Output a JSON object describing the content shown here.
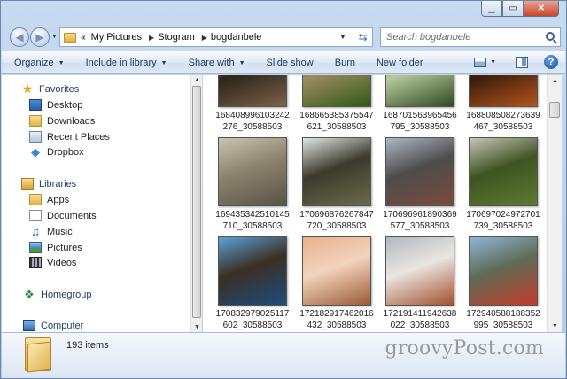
{
  "window": {
    "caption_buttons": [
      "minimize",
      "maximize",
      "close"
    ],
    "accent": "#c8452b"
  },
  "address_bar": {
    "chevron": "«",
    "segments": [
      "My Pictures",
      "Stogram",
      "bogdanbele"
    ]
  },
  "search": {
    "placeholder": "Search bogdanbele"
  },
  "command_bar": {
    "organize": "Organize",
    "include": "Include in library",
    "share": "Share with",
    "slideshow": "Slide show",
    "burn": "Burn",
    "new_folder": "New folder",
    "help": "?"
  },
  "nav": {
    "favorites": "Favorites",
    "desktop": "Desktop",
    "downloads": "Downloads",
    "recent": "Recent Places",
    "dropbox": "Dropbox",
    "libraries": "Libraries",
    "apps": "Apps",
    "documents": "Documents",
    "music": "Music",
    "pictures": "Pictures",
    "videos": "Videos",
    "homegroup": "Homegroup",
    "computer": "Computer"
  },
  "files": [
    {
      "line1": "168408996103242",
      "line2": "276_30588503",
      "colors": [
        "#d9c6a8",
        "#7a6248",
        "#2d241a"
      ]
    },
    {
      "line1": "168665385375547",
      "line2": "621_30588503",
      "colors": [
        "#4f8a2e",
        "#2d5a18",
        "#9c8a60"
      ]
    },
    {
      "line1": "168701563965456",
      "line2": "795_30588503",
      "colors": [
        "#6e9f45",
        "#2f4a22",
        "#b4c79a"
      ]
    },
    {
      "line1": "168808508273639",
      "line2": "467_30588503",
      "colors": [
        "#1a0f08",
        "#b4541b",
        "#3a1d0c"
      ]
    },
    {
      "line1": "169435342510145",
      "line2": "710_30588503",
      "colors": [
        "#c9c4b3",
        "#595346",
        "#8b836d"
      ]
    },
    {
      "line1": "170696876267847",
      "line2": "720_30588503",
      "colors": [
        "#e0e6e4",
        "#6c6b4c",
        "#3b3a2b"
      ]
    },
    {
      "line1": "170696961890369",
      "line2": "577_30588503",
      "colors": [
        "#aeb7c3",
        "#7a4c3a",
        "#4d4d4d"
      ]
    },
    {
      "line1": "170697024972701",
      "line2": "739_30588503",
      "colors": [
        "#c8c4b8",
        "#5e7a32",
        "#3f5421"
      ]
    },
    {
      "line1": "170832979025117",
      "line2": "602_30588503",
      "colors": [
        "#5aa2d8",
        "#1e4c7c",
        "#3b2f22"
      ]
    },
    {
      "line1": "172182917462016",
      "line2": "432_30588503",
      "colors": [
        "#e8b08a",
        "#9c5a36",
        "#f2d4bc"
      ]
    },
    {
      "line1": "172191411942638",
      "line2": "022_30588503",
      "colors": [
        "#b2b8bf",
        "#a4502e",
        "#e9e6e0"
      ]
    },
    {
      "line1": "172940588188352",
      "line2": "995_30588503",
      "colors": [
        "#8fb6d8",
        "#c43b2a",
        "#5d6c54"
      ]
    }
  ],
  "status": {
    "count": "193 items"
  },
  "watermark": "groovyPost.com"
}
